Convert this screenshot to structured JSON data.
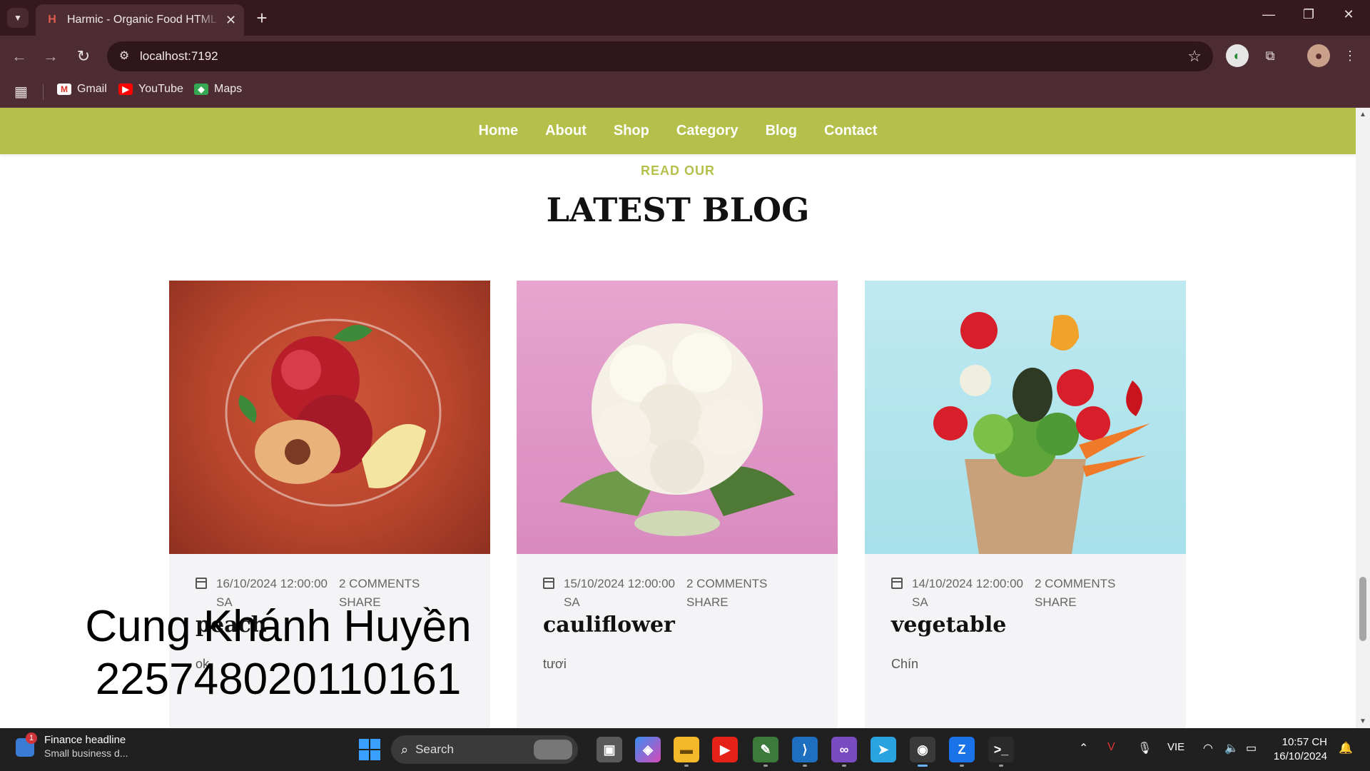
{
  "browser": {
    "tab_title": "Harmic - Organic Food HTML Template",
    "url": "localhost:7192",
    "bookmarks": [
      {
        "label": "Gmail",
        "icon": "gmail-icon"
      },
      {
        "label": "YouTube",
        "icon": "youtube-icon"
      },
      {
        "label": "Maps",
        "icon": "maps-icon"
      }
    ]
  },
  "site": {
    "nav": [
      "Home",
      "About",
      "Shop",
      "Category",
      "Blog",
      "Contact"
    ],
    "accent_color": "#b4c04a"
  },
  "section": {
    "eyebrow": "READ OUR",
    "heading": "LATEST BLOG"
  },
  "posts": [
    {
      "date": "16/10/2024 12:00:00",
      "date_suffix": "SA",
      "comments": "2 COMMENTS",
      "share": "SHARE",
      "title": "peach",
      "excerpt": "ok"
    },
    {
      "date": "15/10/2024 12:00:00",
      "date_suffix": "SA",
      "comments": "2 COMMENTS",
      "share": "SHARE",
      "title": "cauliflower",
      "excerpt": "tươi"
    },
    {
      "date": "14/10/2024 12:00:00",
      "date_suffix": "SA",
      "comments": "2 COMMENTS",
      "share": "SHARE",
      "title": "vegetable",
      "excerpt": "Chín"
    }
  ],
  "overlay": {
    "line1": "Cung Khánh Huyền",
    "line2": "22574802011016​1"
  },
  "taskbar": {
    "news_badge": "1",
    "news_title": "Finance headline",
    "news_sub": "Small business d...",
    "search_label": "Search",
    "language": "VIE",
    "time": "10:57 CH",
    "date": "16/10/2024"
  }
}
